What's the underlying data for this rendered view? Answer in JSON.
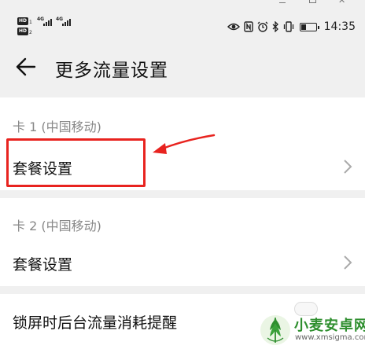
{
  "status_bar": {
    "sim1_badge": "HD",
    "sim1_num": "1",
    "sim1_network": "4G",
    "sim2_badge": "HD",
    "sim2_num": "2",
    "sim2_network": "4G",
    "time": "14:35",
    "battery_level": 0.35,
    "icons": [
      "eye-comfort-icon",
      "nfc-icon",
      "alarm-icon",
      "bluetooth-icon",
      "vibrate-icon",
      "battery-icon"
    ]
  },
  "header": {
    "title": "更多流量设置",
    "back_icon": "arrow-left-icon"
  },
  "sections": [
    {
      "label": "卡 1 (中国移动)",
      "item_label": "套餐设置"
    },
    {
      "label": "卡 2 (中国移动)",
      "item_label": "套餐设置"
    }
  ],
  "lockscreen_row": {
    "label": "锁屏时后台流量消耗提醒"
  },
  "annotation": {
    "color": "#e8231f"
  },
  "watermark": {
    "title": "小麦安卓网",
    "url": "www.xmsigma.com"
  },
  "colors": {
    "background": "#f0f0f0",
    "card": "#ffffff",
    "text": "#111111",
    "secondary": "#888888",
    "brand_green": "#2f8f2f"
  }
}
